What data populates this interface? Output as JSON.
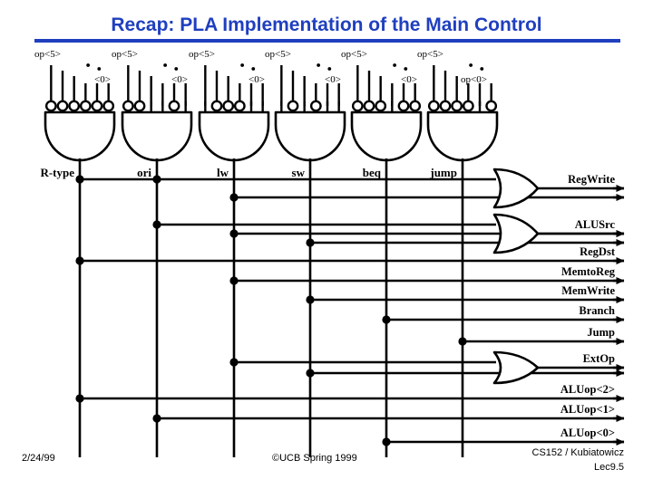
{
  "slide": {
    "title": "Recap: PLA Implementation of the Main Control",
    "title_color": "#1f3fbf",
    "rule_color": "#1f3fbf"
  },
  "footer": {
    "date": "2/24/99",
    "center": "©UCB Spring 1999",
    "course": "CS152 / Kubiatowicz",
    "lecture": "Lec9.5"
  },
  "and_plane": {
    "input_top_label": "op<5>",
    "input_bottom_label": "<0>",
    "input_bottom_label_last": "op<0>",
    "ellipsis": "• •",
    "gates": [
      {
        "name": "R-type",
        "bubbles": [
          true,
          true,
          true,
          true,
          true,
          true
        ]
      },
      {
        "name": "ori",
        "bubbles": [
          true,
          true,
          false,
          false,
          true,
          false
        ]
      },
      {
        "name": "lw",
        "bubbles": [
          false,
          true,
          true,
          true,
          false,
          false
        ]
      },
      {
        "name": "sw",
        "bubbles": [
          false,
          true,
          false,
          true,
          false,
          false
        ]
      },
      {
        "name": "beq",
        "bubbles": [
          true,
          true,
          true,
          false,
          true,
          true
        ]
      },
      {
        "name": "jump",
        "bubbles": [
          true,
          true,
          true,
          true,
          false,
          true
        ]
      }
    ]
  },
  "or_plane": {
    "outputs": [
      {
        "label": "RegWrite",
        "gate": true,
        "taps": [
          "R-type",
          "ori"
        ]
      },
      {
        "label": "",
        "gate": false,
        "taps": [
          "lw"
        ]
      },
      {
        "label": "ALUSrc",
        "gate": true,
        "taps": [
          "ori"
        ]
      },
      {
        "label": "",
        "gate": false,
        "taps": [
          "lw"
        ]
      },
      {
        "label": "",
        "gate": false,
        "taps": [
          "sw"
        ]
      },
      {
        "label": "RegDst",
        "gate": false,
        "taps": [
          "R-type"
        ]
      },
      {
        "label": "MemtoReg",
        "gate": false,
        "taps": [
          "lw"
        ]
      },
      {
        "label": "MemWrite",
        "gate": false,
        "taps": [
          "sw"
        ]
      },
      {
        "label": "Branch",
        "gate": false,
        "taps": [
          "beq"
        ]
      },
      {
        "label": "Jump",
        "gate": false,
        "taps": [
          "jump"
        ]
      },
      {
        "label": "ExtOp",
        "gate": true,
        "taps": [
          "lw"
        ]
      },
      {
        "label": "",
        "gate": false,
        "taps": [
          "sw"
        ]
      },
      {
        "label": "ALUop<2>",
        "gate": false,
        "taps": [
          "R-type"
        ]
      },
      {
        "label": "ALUop<1>",
        "gate": false,
        "taps": [
          "ori"
        ]
      },
      {
        "label": "ALUop<0>",
        "gate": false,
        "taps": [
          "beq"
        ]
      }
    ]
  }
}
